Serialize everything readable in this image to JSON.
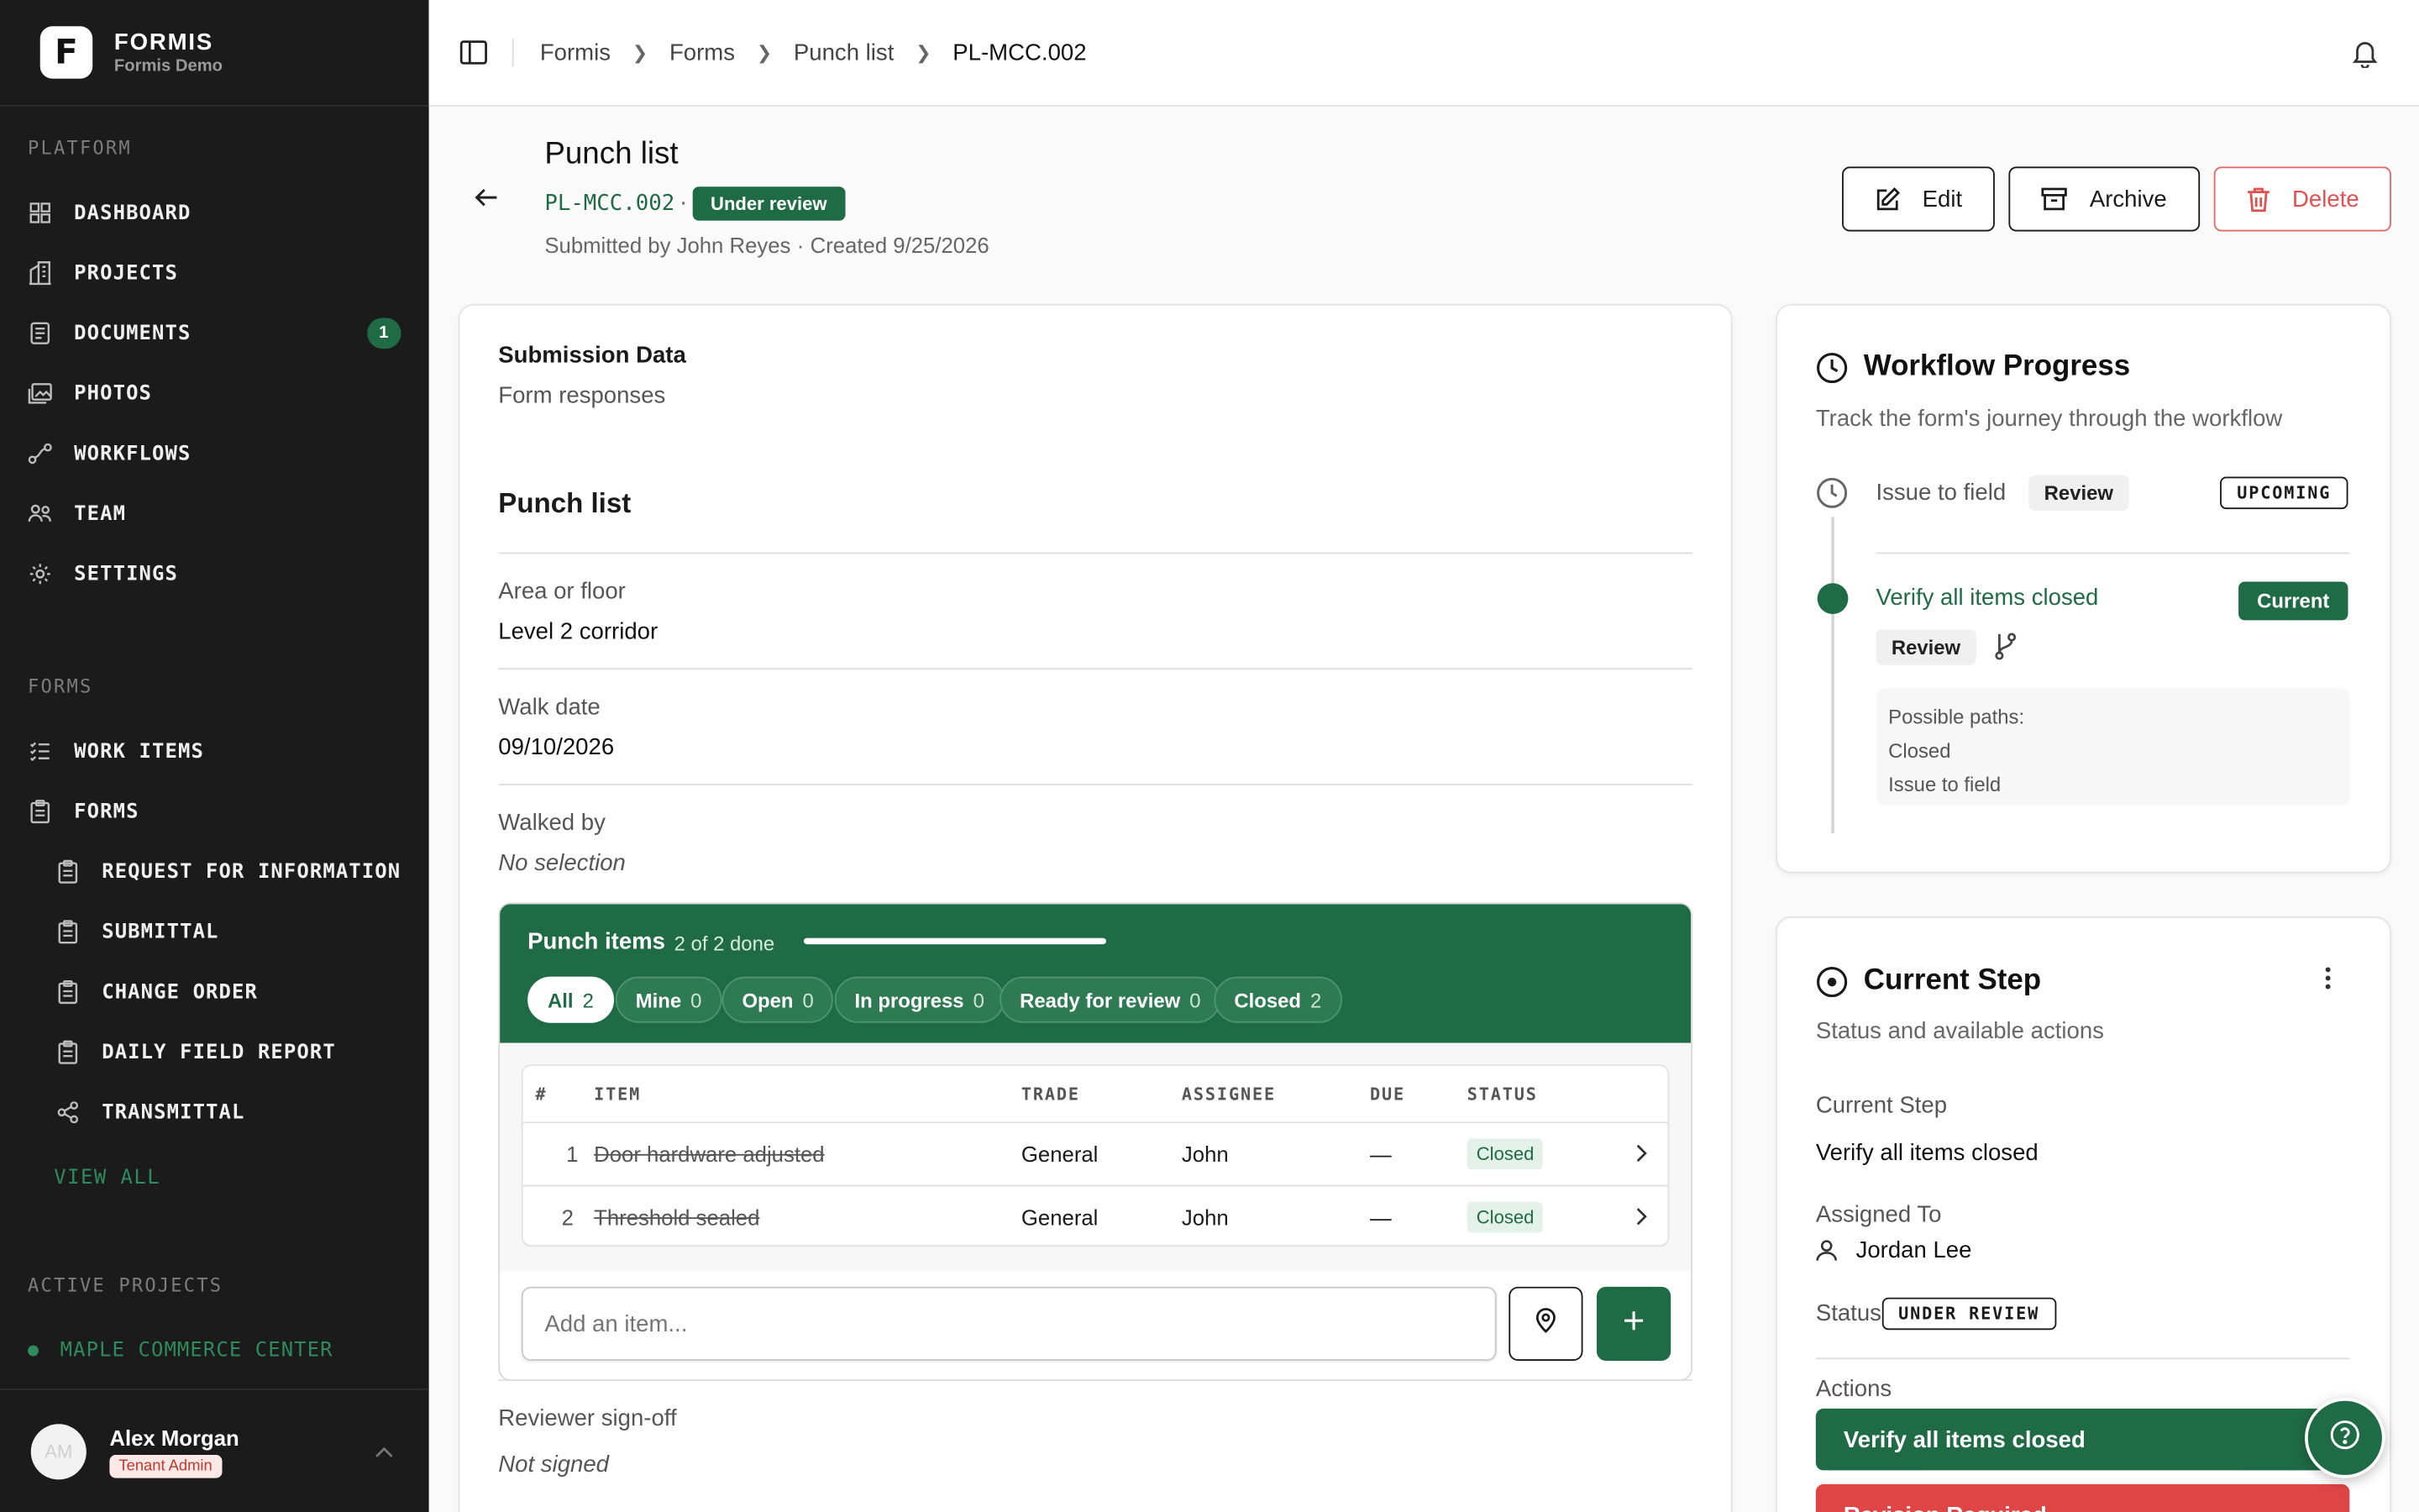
{
  "brand": {
    "name": "FORMIS",
    "subtitle": "Formis Demo",
    "logo_letter": "F"
  },
  "sidebar": {
    "platform_label": "PLATFORM",
    "platform_items": [
      {
        "label": "DASHBOARD",
        "icon": "grid-icon"
      },
      {
        "label": "PROJECTS",
        "icon": "building-icon"
      },
      {
        "label": "DOCUMENTS",
        "icon": "document-icon",
        "badge": "1"
      },
      {
        "label": "PHOTOS",
        "icon": "photos-icon"
      },
      {
        "label": "WORKFLOWS",
        "icon": "workflow-icon"
      },
      {
        "label": "TEAM",
        "icon": "team-icon"
      },
      {
        "label": "SETTINGS",
        "icon": "gear-icon"
      }
    ],
    "forms_label": "FORMS",
    "forms_items": [
      {
        "label": "WORK ITEMS",
        "icon": "list-icon"
      },
      {
        "label": "FORMS",
        "icon": "clipboard-icon"
      }
    ],
    "form_types": [
      {
        "label": "REQUEST FOR INFORMATION"
      },
      {
        "label": "SUBMITTAL"
      },
      {
        "label": "CHANGE ORDER"
      },
      {
        "label": "DAILY FIELD REPORT"
      },
      {
        "label": "TRANSMITTAL"
      }
    ],
    "view_all": "VIEW ALL",
    "active_projects_label": "ACTIVE PROJECTS",
    "active_project": "MAPLE COMMERCE CENTER"
  },
  "user": {
    "initials": "AM",
    "name": "Alex Morgan",
    "role": "Tenant Admin"
  },
  "breadcrumb": [
    "Formis",
    "Forms",
    "Punch list",
    "PL-MCC.002"
  ],
  "header": {
    "title": "Punch list",
    "doc_id": "PL-MCC.002",
    "status": "Under review",
    "submitted_by": "Submitted by John Reyes",
    "created": "Created 9/25/2026",
    "edit": "Edit",
    "archive": "Archive",
    "delete": "Delete"
  },
  "submission": {
    "title": "Submission Data",
    "subtitle": "Form responses",
    "form_title": "Punch list",
    "fields": [
      {
        "label": "Area or floor",
        "value": "Level 2 corridor"
      },
      {
        "label": "Walk date",
        "value": "09/10/2026"
      },
      {
        "label": "Walked by",
        "value": "No selection"
      }
    ],
    "reviewer_label": "Reviewer sign-off",
    "reviewer_value": "Not signed"
  },
  "punch_items": {
    "title": "Punch items",
    "progress_text": "2 of 2 done",
    "progress": 1.0,
    "filters": [
      {
        "label": "All",
        "count": "2"
      },
      {
        "label": "Mine",
        "count": "0"
      },
      {
        "label": "Open",
        "count": "0"
      },
      {
        "label": "In progress",
        "count": "0"
      },
      {
        "label": "Ready for review",
        "count": "0"
      },
      {
        "label": "Closed",
        "count": "2"
      }
    ],
    "columns": [
      "#",
      "ITEM",
      "TRADE",
      "ASSIGNEE",
      "DUE",
      "STATUS"
    ],
    "rows": [
      {
        "num": "1",
        "item": "Door hardware adjusted",
        "trade": "General",
        "assignee": "John",
        "due": "—",
        "status": "Closed"
      },
      {
        "num": "2",
        "item": "Threshold sealed",
        "trade": "General",
        "assignee": "John",
        "due": "—",
        "status": "Closed"
      }
    ],
    "add_placeholder": "Add an item..."
  },
  "workflow": {
    "title": "Workflow Progress",
    "subtitle": "Track the form's journey through the workflow",
    "steps": [
      {
        "name": "Issue to field",
        "tag": "Review",
        "state": "UPCOMING"
      },
      {
        "name": "Verify all items closed",
        "tag": "Review",
        "state": "Current"
      }
    ],
    "paths_label": "Possible paths:",
    "paths": [
      "Closed",
      "Issue to field"
    ]
  },
  "current_step": {
    "title": "Current Step",
    "subtitle": "Status and available actions",
    "step_label": "Current Step",
    "step_value": "Verify all items closed",
    "assigned_label": "Assigned To",
    "assigned_value": "Jordan Lee",
    "status_label": "Status",
    "status_value": "UNDER REVIEW",
    "actions_label": "Actions",
    "primary_action": "Verify all items closed",
    "secondary_action": "Revision Required"
  },
  "colors": {
    "accent": "#1f6b45",
    "danger": "#e05050",
    "sidebar": "#1b1b1b"
  }
}
